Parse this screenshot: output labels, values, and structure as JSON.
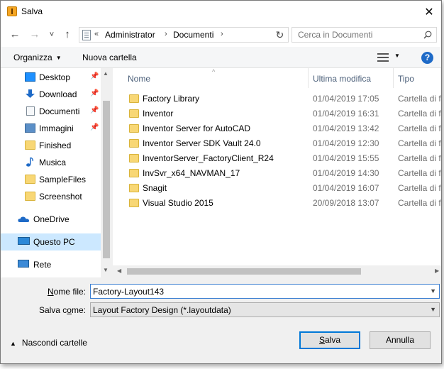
{
  "window": {
    "title": "Salva",
    "close_glyph": "✕",
    "app_icon": "inventor-app-icon"
  },
  "nav": {
    "back_glyph": "←",
    "forward_glyph": "→",
    "history_glyph": "˅",
    "up_glyph": "↑",
    "address": {
      "overflow": "«",
      "segments": [
        "Administrator",
        "Documenti"
      ],
      "sep": "›"
    },
    "refresh_glyph": "↻",
    "search_placeholder": "Cerca in Documenti"
  },
  "toolbar": {
    "organize": "Organizza",
    "new_folder": "Nuova cartella",
    "help": "?"
  },
  "sidebar": {
    "items": [
      {
        "label": "Desktop",
        "icon": "desktop-icon",
        "pinned": true
      },
      {
        "label": "Download",
        "icon": "download-icon",
        "pinned": true
      },
      {
        "label": "Documenti",
        "icon": "documents-icon",
        "pinned": true
      },
      {
        "label": "Immagini",
        "icon": "pictures-icon",
        "pinned": true
      },
      {
        "label": "Finished",
        "icon": "folder-icon",
        "pinned": false
      },
      {
        "label": "Musica",
        "icon": "music-icon",
        "pinned": false
      },
      {
        "label": "SampleFiles",
        "icon": "folder-icon",
        "pinned": false
      },
      {
        "label": "Screenshot",
        "icon": "folder-icon",
        "pinned": false
      },
      {
        "label": "OneDrive",
        "icon": "onedrive-icon",
        "pinned": false
      },
      {
        "label": "Questo PC",
        "icon": "this-pc-icon",
        "pinned": false,
        "selected": true
      },
      {
        "label": "Rete",
        "icon": "network-icon",
        "pinned": false
      }
    ],
    "pin_glyph": "📌"
  },
  "filelist": {
    "columns": {
      "name": "Nome",
      "modified": "Ultima modifica",
      "type": "Tipo"
    },
    "rows": [
      {
        "name": "Factory Library",
        "modified": "01/04/2019 17:05",
        "type": "Cartella di file"
      },
      {
        "name": "Inventor",
        "modified": "01/04/2019 16:31",
        "type": "Cartella di file"
      },
      {
        "name": "Inventor Server for AutoCAD",
        "modified": "01/04/2019 13:42",
        "type": "Cartella di file"
      },
      {
        "name": "Inventor Server SDK Vault 24.0",
        "modified": "01/04/2019 12:30",
        "type": "Cartella di file"
      },
      {
        "name": "InventorServer_FactoryClient_R24",
        "modified": "01/04/2019 15:55",
        "type": "Cartella di file"
      },
      {
        "name": "InvSvr_x64_NAVMAN_17",
        "modified": "01/04/2019 14:30",
        "type": "Cartella di file"
      },
      {
        "name": "Snagit",
        "modified": "01/04/2019 16:07",
        "type": "Cartella di file"
      },
      {
        "name": "Visual Studio 2015",
        "modified": "20/09/2018 13:07",
        "type": "Cartella di file"
      }
    ]
  },
  "form": {
    "filename_label_u": "N",
    "filename_label_rest": "ome file:",
    "filename_value": "Factory-Layout143",
    "savetype_label_pre": "Salva c",
    "savetype_label_u": "o",
    "savetype_label_rest": "me:",
    "savetype_value": "Layout Factory Design (*.layoutdata)"
  },
  "footer": {
    "hide_folders": "Nascondi cartelle",
    "save_u": "S",
    "save_rest": "alva",
    "cancel": "Annulla"
  },
  "colors": {
    "accent": "#0078d7",
    "selection": "#cce8ff",
    "folder": "#f8d775",
    "header_text": "#4c607a"
  }
}
